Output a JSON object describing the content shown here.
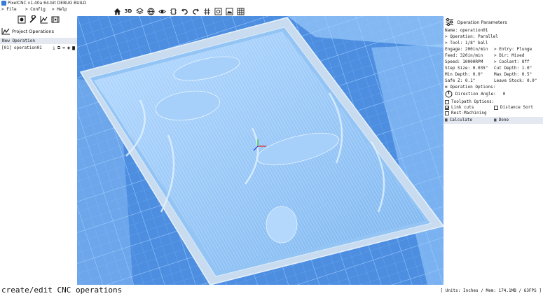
{
  "window": {
    "title": "PixelCNC v1.40a 64-bit DEBUG BUILD"
  },
  "menu": [
    {
      "label": "> File"
    },
    {
      "label": "> Config"
    },
    {
      "label": "> Help"
    }
  ],
  "toolbar": [
    {
      "icon": "home-icon",
      "glyph": "⌂"
    },
    {
      "icon": "3d-view-icon",
      "glyph": "3D"
    },
    {
      "icon": "layers-icon",
      "glyph": "◈"
    },
    {
      "icon": "globe-icon",
      "glyph": "◍"
    },
    {
      "icon": "eye-icon",
      "glyph": "◉"
    },
    {
      "icon": "chip-icon",
      "glyph": "▤"
    },
    {
      "icon": "undo-icon",
      "glyph": "↶"
    },
    {
      "icon": "redo-icon",
      "glyph": "↷"
    },
    {
      "icon": "grid-icon",
      "glyph": "#"
    },
    {
      "icon": "settings-icon",
      "glyph": "⚙"
    },
    {
      "icon": "image-icon",
      "glyph": "▣"
    },
    {
      "icon": "table-icon",
      "glyph": "▦"
    }
  ],
  "left": {
    "section_title": "Project Operations",
    "new_operation": "New Operation",
    "operations": [
      {
        "label": "[01] operation01"
      }
    ]
  },
  "right": {
    "title": "Operation Parameters",
    "name": "Name: operation01",
    "operation": "> Operation: Parallel",
    "tool": "> Tool: 1/8\" ball",
    "engage": "Engage: 200in/min",
    "entry": "> Entry: Plunge",
    "feed": "Feed: 320in/min",
    "dir": "> Dir: Mixed",
    "speed": "Speed: 10000RPM",
    "coolant": "> Coolant: Off",
    "step_size": "Step Size: 0.035\"",
    "cut_depth": "Cut Depth: 1.0\"",
    "min_depth": "Min Depth: 0.0\"",
    "max_depth": "Max Depth: 0.5\"",
    "safe_z": "Safe Z: 0.1\"",
    "leave_stock": "Leave Stock: 0.0\"",
    "op_options": "Operation Options:",
    "dir_angle_label": "Direction Angle:",
    "dir_angle_value": "0",
    "toolpath_options": "Toolpath Options:",
    "link_cuts": "Link cuts",
    "link_cuts_checked": true,
    "distance_sort": "Distance Sort",
    "distance_sort_checked": false,
    "rest_machining": "Rest-Machining",
    "rest_machining_checked": false,
    "calculate": "Calculate",
    "done": "Done"
  },
  "status": {
    "text": "create/edit CNC operations",
    "right": "[ Units: Inches / Mem: 174.1MB / 63FPS ]"
  },
  "colors": {
    "viewport_bg": "#4d8ee0",
    "stock": "#8fc4f5",
    "grid_line": "#6aa8ee",
    "frame": "#c6d6ea",
    "panel_highlight": "#e4e8f0"
  }
}
